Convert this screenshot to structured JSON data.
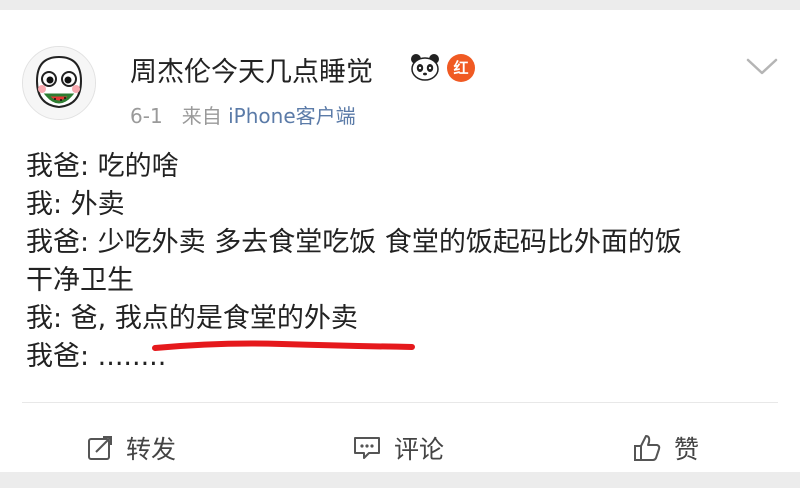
{
  "user": {
    "name": "周杰伦今天几点睡觉",
    "badge_red_label": "红"
  },
  "meta": {
    "date": "6-1",
    "source_prefix": "来自",
    "source": "iPhone客户端"
  },
  "post": {
    "lines": [
      "我爸: 吃的啥",
      "我: 外卖",
      "我爸: 少吃外卖 多去食堂吃饭 食堂的饭起码比外面的饭",
      "干净卫生",
      "我: 爸, 我点的是食堂的外卖",
      "我爸: ........"
    ]
  },
  "actions": {
    "repost": "转发",
    "comment": "评论",
    "like": "赞"
  },
  "colors": {
    "accent_link": "#5b7ba8",
    "badge_red": "#f05a23",
    "underline": "#e5191c"
  }
}
